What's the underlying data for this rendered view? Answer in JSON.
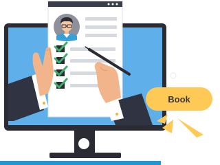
{
  "cta": {
    "label": "Book"
  },
  "icons": {
    "monitor": "monitor-icon",
    "document": "checklist-document-icon",
    "avatar": "profile-avatar-icon",
    "checkmark": "checkmark-icon",
    "pen": "pen-icon",
    "spark": "spark-icon",
    "power": "power-button-icon"
  },
  "colors": {
    "screen": "#5fb0ea",
    "bezel": "#2b2b33",
    "paper": "#ffffff",
    "checkmark": "#3db06a",
    "checkbox": "#2b2b33",
    "sleeve": "#2f3342",
    "skin": "#f2b48a",
    "cta": "#ffc955",
    "accent_bar": "#1f97d4",
    "spark": "#ffc955"
  }
}
